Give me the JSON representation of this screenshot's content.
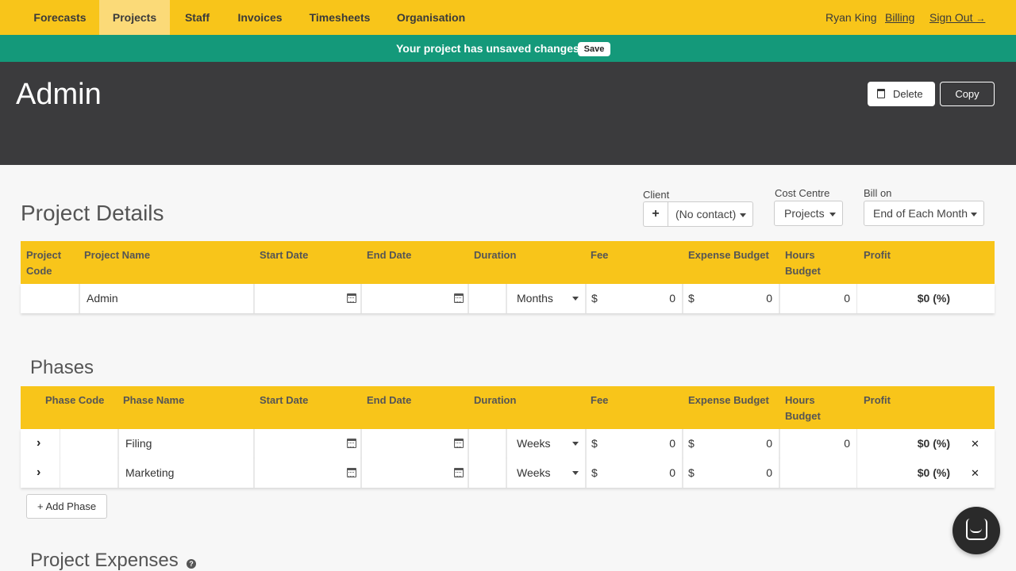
{
  "nav": {
    "items": [
      {
        "label": "Forecasts",
        "active": false
      },
      {
        "label": "Projects",
        "active": true
      },
      {
        "label": "Staff",
        "active": false
      },
      {
        "label": "Invoices",
        "active": false
      },
      {
        "label": "Timesheets",
        "active": false
      },
      {
        "label": "Organisation",
        "active": false
      }
    ],
    "user": "Ryan King",
    "billing": "Billing",
    "signout": "Sign Out"
  },
  "banner": {
    "message": "Your project has unsaved changes.",
    "save_label": "Save"
  },
  "header": {
    "title": "Admin",
    "delete_label": "Delete",
    "copy_label": "Copy"
  },
  "project_details": {
    "title": "Project Details",
    "client_label": "Client",
    "client_value": "(No contact)",
    "client_add": "+",
    "cost_centre_label": "Cost Centre",
    "cost_centre_value": "Projects",
    "bill_on_label": "Bill on",
    "bill_on_value": "End of Each Month",
    "columns": [
      "Project Code",
      "Project Name",
      "Start Date",
      "End Date",
      "Duration",
      "Fee",
      "Expense Budget",
      "Hours Budget",
      "Profit"
    ],
    "row": {
      "code": "",
      "name": "Admin",
      "start": "",
      "end": "",
      "duration_unit": "Months",
      "fee_currency": "$",
      "fee": "0",
      "expense_currency": "$",
      "expense": "0",
      "hours": "0",
      "profit": "$0 (%)"
    }
  },
  "phases": {
    "title": "Phases",
    "columns": [
      "Phase Code",
      "Phase Name",
      "Start Date",
      "End Date",
      "Duration",
      "Fee",
      "Expense Budget",
      "Hours Budget",
      "Profit"
    ],
    "rows": [
      {
        "name": "Filing",
        "duration_unit": "Weeks",
        "fee_currency": "$",
        "fee": "0",
        "expense_currency": "$",
        "expense": "0",
        "hours": "0",
        "profit": "$0 (%)"
      },
      {
        "name": "Marketing",
        "duration_unit": "Weeks",
        "fee_currency": "$",
        "fee": "0",
        "expense_currency": "$",
        "expense": "0",
        "hours": "",
        "profit": "$0 (%)"
      }
    ],
    "add_label": "+ Add Phase"
  },
  "expenses": {
    "title": "Project Expenses",
    "help": "?"
  },
  "icons": {
    "trash": "trash-icon",
    "calendar": "calendar-icon",
    "caret": "caret-down-icon",
    "chevron": "chevron-right-icon",
    "close": "close-icon",
    "chat": "chat-icon",
    "signout": "sign-out-icon"
  },
  "colors": {
    "nav": "#f8c51a",
    "nav_active": "#fbda78",
    "banner": "#14997a",
    "header": "#3b3b3d"
  }
}
